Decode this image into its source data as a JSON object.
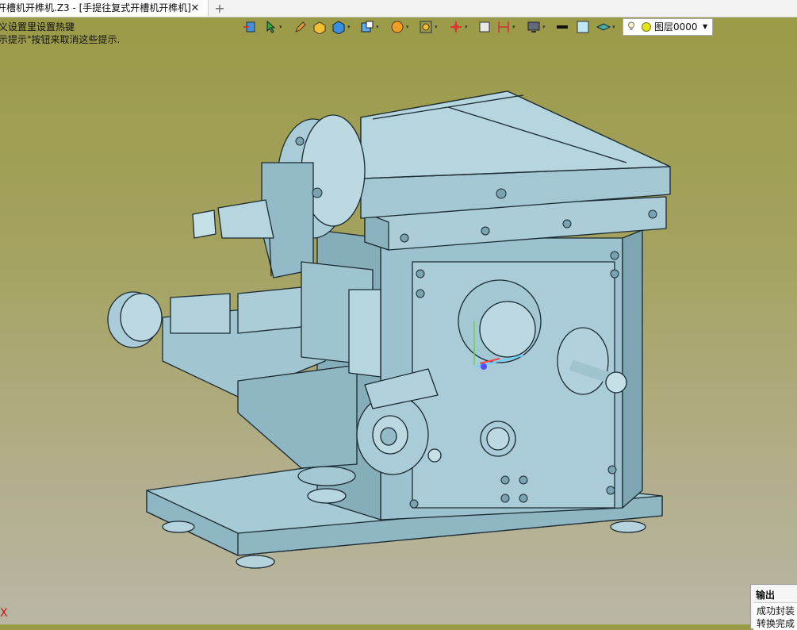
{
  "tab": {
    "title": "开槽机开榫机.Z3 - [手提往复式开槽机开榫机]",
    "close_glyph": "✕",
    "add_glyph": "+"
  },
  "hints": {
    "line1": "义设置里设置热键",
    "line2": "示提示\"按钮来取消这些提示."
  },
  "toolbar": {
    "icons": [
      "import-icon",
      "pointer-icon",
      "pen-icon",
      "box-icon",
      "solid-icon",
      "view-cube-icon",
      "render-sphere-icon",
      "zoom-fit-icon",
      "axis-icon",
      "frame-icon",
      "dimension-icon",
      "monitor-icon",
      "line-style-icon",
      "color-icon",
      "layer-stack-icon"
    ],
    "layer_label": "图层0000"
  },
  "output": {
    "title": "输出",
    "line1": "成功封装",
    "line2": "转换完成"
  },
  "axis_label": "X",
  "colors": {
    "model_fill": "#9fc4d0",
    "model_dark": "#7aa3b1",
    "model_edge": "#1b2b31",
    "background_top": "#9a9a46",
    "background_bottom": "#b9b6a4"
  }
}
